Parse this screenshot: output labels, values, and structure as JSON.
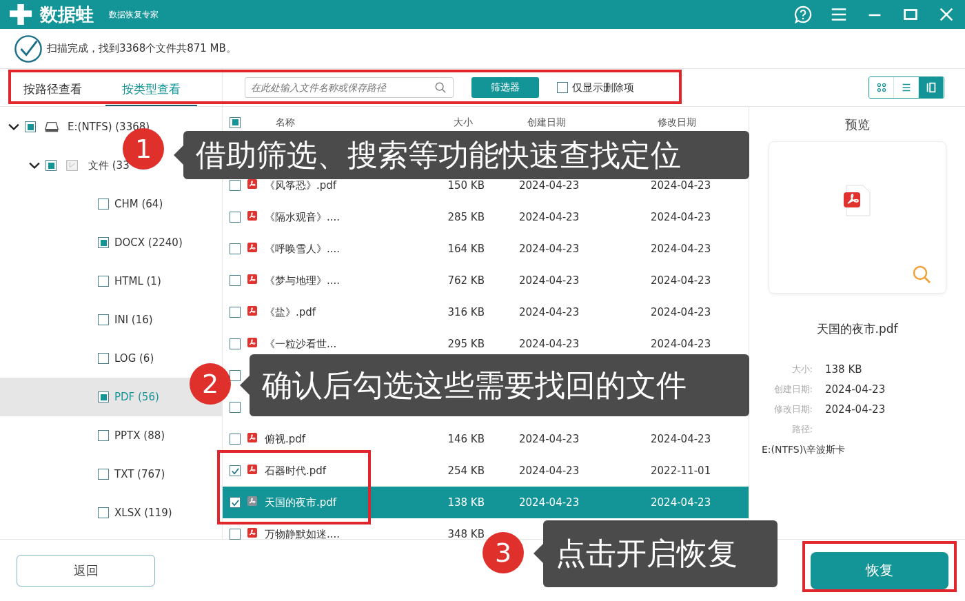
{
  "window": {
    "app_name": "数据蛙",
    "subtitle": "数据恢复专家"
  },
  "scan_status": "扫描完成，找到3368个文件共871 MB。",
  "view_tabs": [
    {
      "label": "按路径查看",
      "selected": false
    },
    {
      "label": "按类型查看",
      "selected": true
    }
  ],
  "search": {
    "placeholder": "在此处输入文件名称或保存路径"
  },
  "filter_button": "筛选器",
  "deleted_only": {
    "label": "仅显示删除项",
    "checked": false
  },
  "view_modes": [
    {
      "kind": "grid",
      "selected": false
    },
    {
      "kind": "list",
      "selected": false
    },
    {
      "kind": "detail",
      "selected": true
    }
  ],
  "tree": [
    {
      "label": "E:(NTFS) (3368)",
      "kind": "drive",
      "checked": true,
      "expanded": true,
      "selected": false,
      "children": [
        {
          "label": "文件 (33",
          "kind": "folder",
          "checked": true,
          "expanded": true,
          "selected": false,
          "children": [
            {
              "label": "CHM (64)",
              "checked": false,
              "selected": false
            },
            {
              "label": "DOCX (2240)",
              "checked": true,
              "selected": false
            },
            {
              "label": "HTML (1)",
              "checked": false,
              "selected": false
            },
            {
              "label": "INI (16)",
              "checked": false,
              "selected": false
            },
            {
              "label": "LOG (6)",
              "checked": false,
              "selected": false
            },
            {
              "label": "PDF (56)",
              "checked": true,
              "selected": true
            },
            {
              "label": "PPTX (88)",
              "checked": false,
              "selected": false
            },
            {
              "label": "TXT (767)",
              "checked": false,
              "selected": false
            },
            {
              "label": "XLSX (119)",
              "checked": false,
              "selected": false
            }
          ]
        }
      ]
    }
  ],
  "table": {
    "header_checked": true,
    "columns": [
      "名称",
      "大小",
      "创建日期",
      "修改日期"
    ],
    "rows": [
      {
        "name": "《风筝恐》.pdf",
        "size": "150 KB",
        "created": "2024-04-23",
        "modified": "2024-04-23",
        "checked": false,
        "selected": false
      },
      {
        "name": "《隔水观音》....",
        "size": "285 KB",
        "created": "2024-04-23",
        "modified": "2024-04-23",
        "checked": false,
        "selected": false
      },
      {
        "name": "《呼唤雪人》....",
        "size": "164 KB",
        "created": "2024-04-23",
        "modified": "2024-04-23",
        "checked": false,
        "selected": false
      },
      {
        "name": "《梦与地理》....",
        "size": "762 KB",
        "created": "2024-04-23",
        "modified": "2024-04-23",
        "checked": false,
        "selected": false
      },
      {
        "name": "《盐》.pdf",
        "size": "316 KB",
        "created": "2024-04-23",
        "modified": "2024-04-23",
        "checked": false,
        "selected": false
      },
      {
        "name": "《一粒沙看世...",
        "size": "295 KB",
        "created": "2024-04-23",
        "modified": "2024-04-23",
        "checked": false,
        "selected": false
      },
      {
        "checked": false,
        "selected": false
      },
      {
        "checked": false,
        "selected": false
      },
      {
        "name": "俯视.pdf",
        "size": "146 KB",
        "created": "2024-04-23",
        "modified": "2024-04-23",
        "checked": false,
        "selected": false
      },
      {
        "name": "石器时代.pdf",
        "size": "254 KB",
        "created": "2024-04-23",
        "modified": "2022-11-01",
        "checked": true,
        "selected": false
      },
      {
        "name": "天国的夜市.pdf",
        "size": "138 KB",
        "created": "2024-04-23",
        "modified": "2024-04-23",
        "checked": true,
        "selected": true
      },
      {
        "name": "万物静默如迷....",
        "size": "348 KB",
        "checked": false,
        "selected": false
      }
    ]
  },
  "preview": {
    "title": "预览",
    "file_name": "天国的夜市.pdf",
    "details": [
      {
        "label": "大小:",
        "value": "138 KB"
      },
      {
        "label": "创建日期:",
        "value": "2024-04-23"
      },
      {
        "label": "修改日期:",
        "value": "2024-04-23"
      },
      {
        "label": "路径:"
      }
    ],
    "path": "E:(NTFS)\\辛波斯卡"
  },
  "back_button": "返回",
  "recover_button": "恢复",
  "callouts": [
    {
      "number": "1",
      "text": "借助筛选、搜索等功能快速查找定位"
    },
    {
      "number": "2",
      "text": "确认后勾选这些需要找回的文件"
    },
    {
      "number": "3",
      "text": "点击开启恢复"
    }
  ]
}
